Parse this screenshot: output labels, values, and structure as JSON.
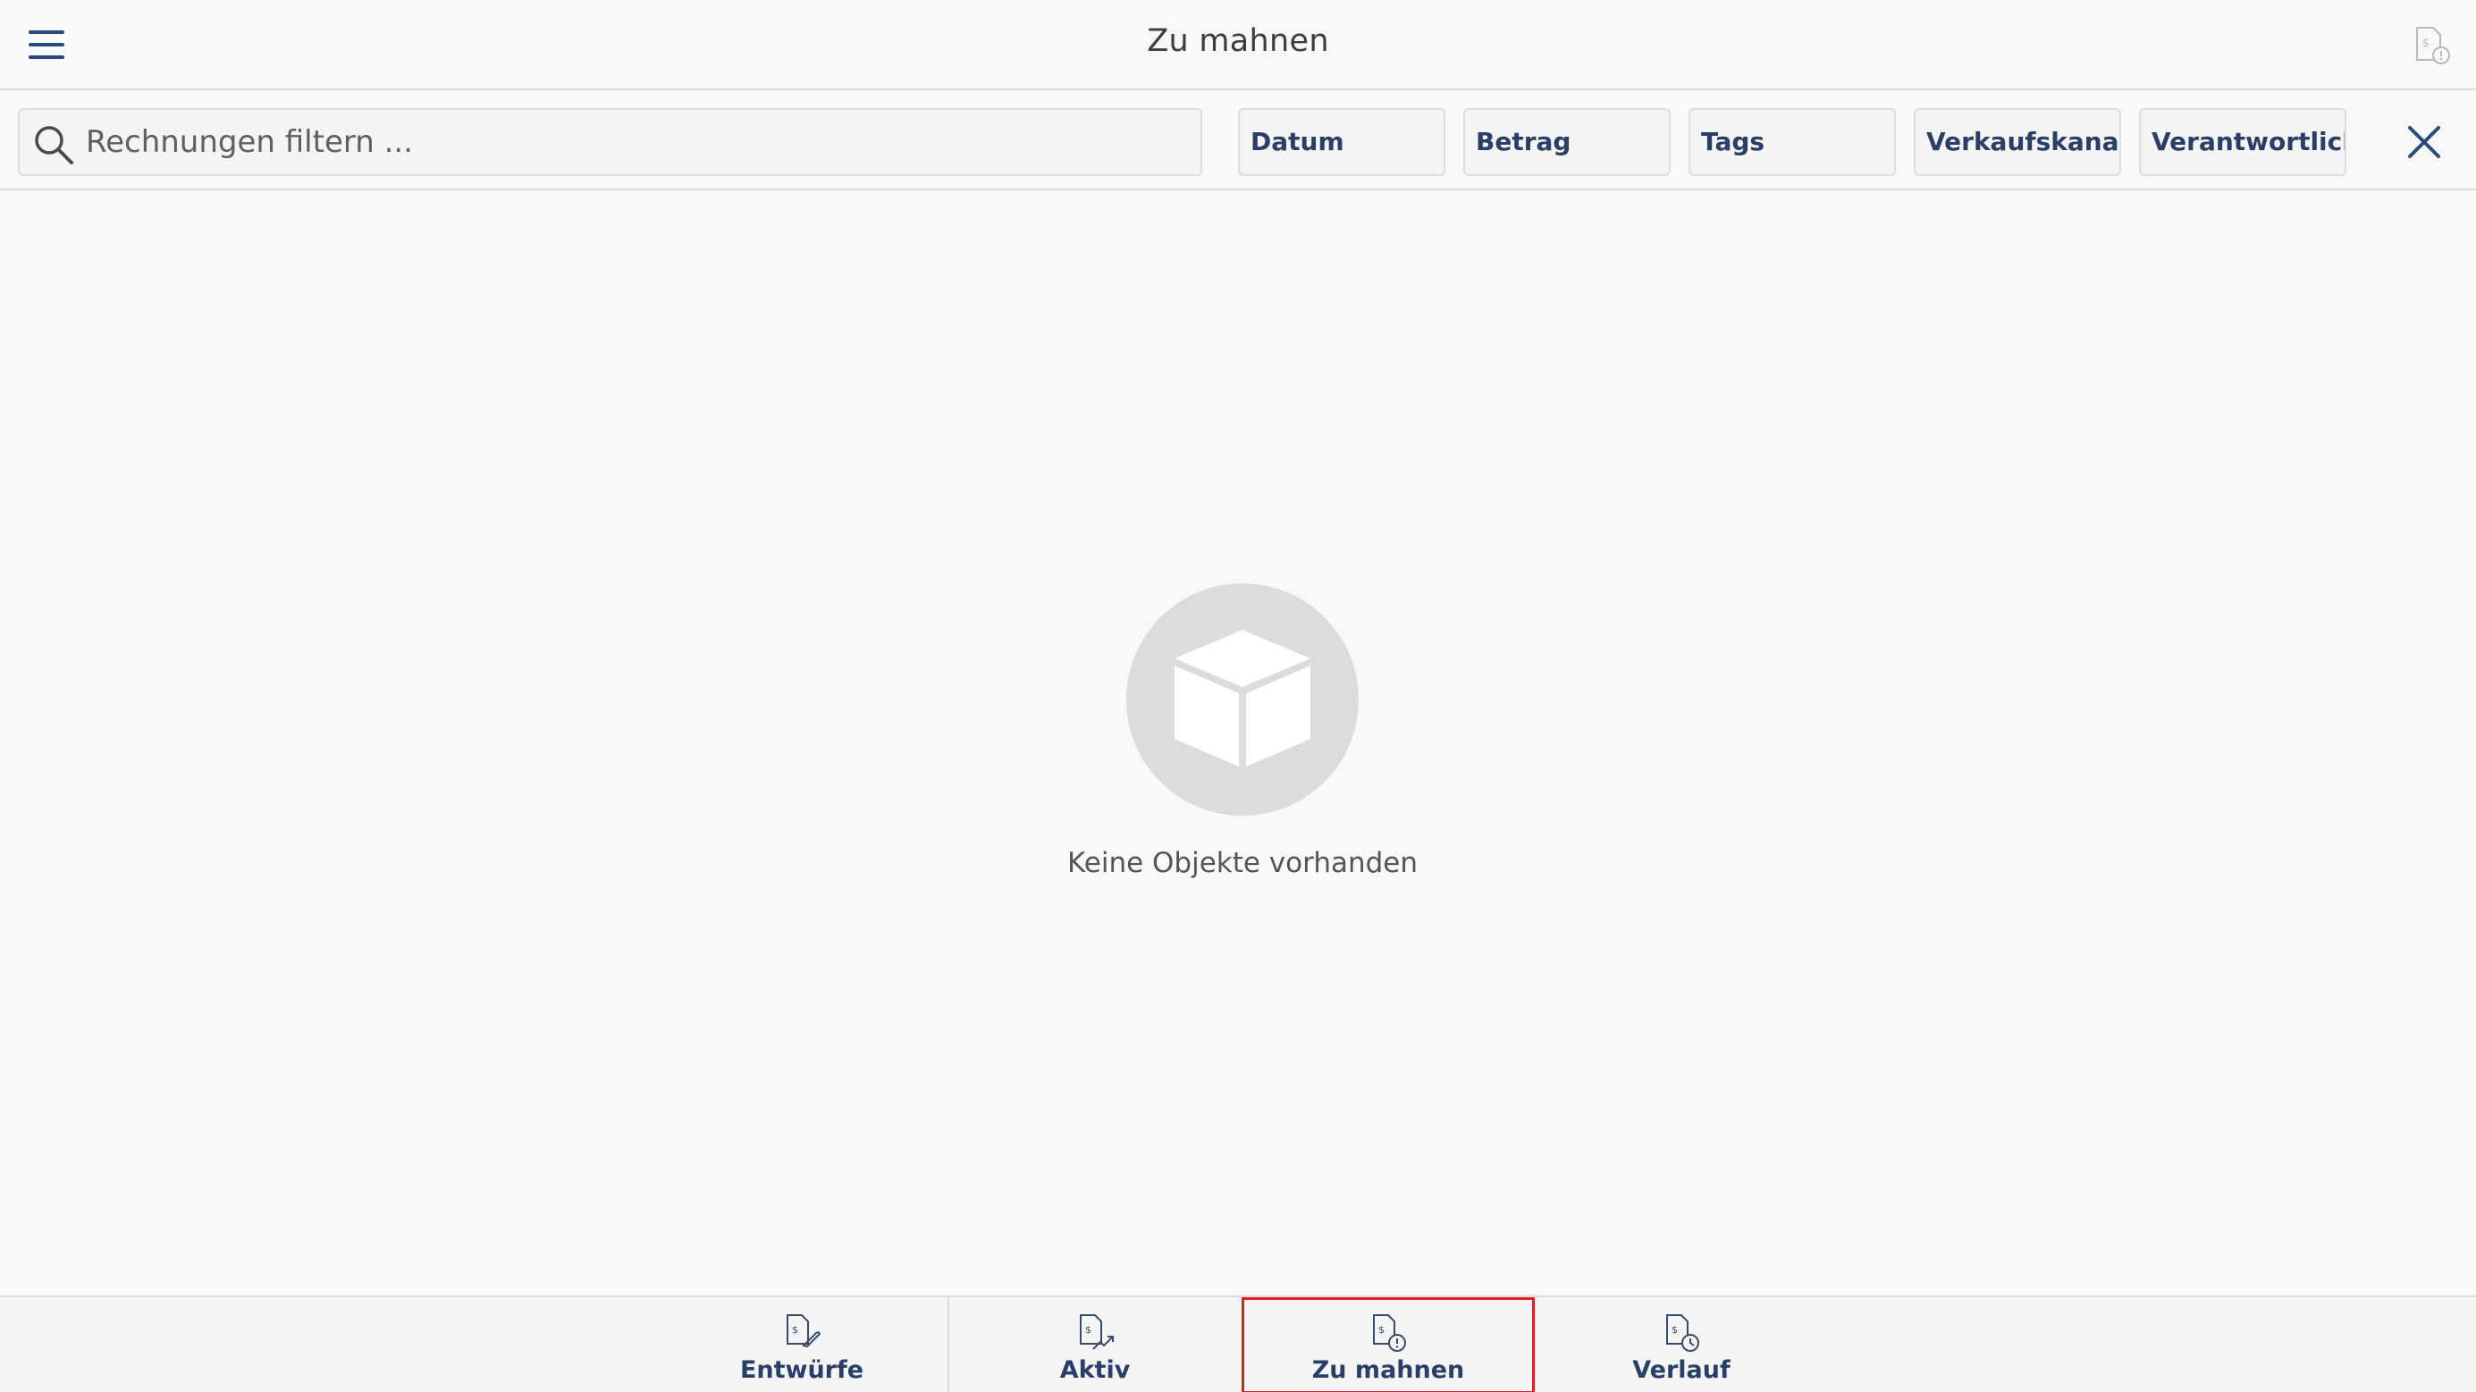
{
  "header": {
    "title": "Zu mahnen",
    "menu_icon": "hamburger-menu-icon",
    "action_icon": "invoice-overdue-icon"
  },
  "filter": {
    "placeholder": "Rechnungen filtern ...",
    "value": "",
    "chips": [
      {
        "label": "Datum"
      },
      {
        "label": "Betrag"
      },
      {
        "label": "Tags"
      },
      {
        "label": "Verkaufskanal"
      },
      {
        "label": "Verantwortlich"
      }
    ]
  },
  "empty_state": {
    "icon": "box-icon",
    "message": "Keine Objekte vorhanden"
  },
  "tabs": [
    {
      "label": "Entwürfe",
      "icon": "invoice-draft-icon",
      "active": false
    },
    {
      "label": "Aktiv",
      "icon": "invoice-active-icon",
      "active": false
    },
    {
      "label": "Zu mahnen",
      "icon": "invoice-overdue-icon",
      "active": true
    },
    {
      "label": "Verlauf",
      "icon": "invoice-history-icon",
      "active": false
    }
  ],
  "colors": {
    "accent": "#2a3f66",
    "menu": "#2a4a7b",
    "active_outline": "#e02020",
    "background": "#f8f8f8"
  }
}
